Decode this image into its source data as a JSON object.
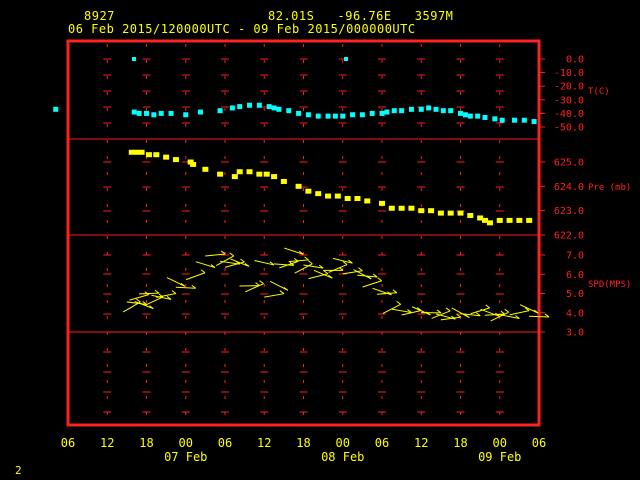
{
  "header": {
    "station": "8927",
    "location": "82.01S   -96.76E   3597M",
    "period": "06 Feb 2015/120000UTC - 09 Feb 2015/000000UTC"
  },
  "page_number": "2",
  "colors": {
    "frame": "#ff2020",
    "temp": "#00ffff",
    "pres": "#ffff00",
    "wind": "#ffff00",
    "text": "#ffff00"
  },
  "chart_data": [
    {
      "type": "scatter",
      "panel": "temperature",
      "ylabel": "T(C)",
      "ylim": [
        -50,
        0
      ],
      "yticks": [
        "0.0",
        "-10.0",
        "-20.0",
        "-30.0",
        "-40.0",
        "-50.0"
      ],
      "grid": true,
      "series": [
        {
          "x": [
            -2.5,
            13.5,
            14.5,
            16,
            17.5,
            19,
            21,
            24,
            27,
            31,
            33.5,
            35,
            37,
            39,
            41,
            42,
            43,
            45,
            47,
            49,
            51,
            53,
            54.5,
            56,
            58,
            60,
            62,
            64,
            65,
            66.5,
            68,
            70,
            72,
            73.5,
            75,
            76.5,
            78,
            80,
            81,
            82,
            83.5,
            85,
            87,
            88.5,
            91,
            93,
            95
          ],
          "y": [
            -37,
            -39,
            -40,
            -40,
            -41,
            -40,
            -40,
            -41,
            -39,
            -38,
            -36,
            -35,
            -34,
            -34,
            -35,
            -36,
            -37,
            -38,
            -40,
            -41,
            -42,
            -42,
            -42,
            -42,
            -41,
            -41,
            -40,
            -40,
            -39,
            -38,
            -38,
            -37,
            -37,
            -36,
            -37,
            -38,
            -38,
            -40,
            -41,
            -42,
            -42,
            -43,
            -44,
            -45,
            -45,
            -45,
            -46
          ]
        }
      ]
    },
    {
      "type": "scatter",
      "panel": "pressure",
      "ylabel": "Pre (mb)",
      "ylim": [
        621.8,
        625.8
      ],
      "yticks": [
        "625.0",
        "624.0",
        "623.0",
        "622.0"
      ],
      "series": [
        {
          "x": [
            13,
            14,
            15,
            16.5,
            18,
            20,
            22,
            25,
            25.5,
            28,
            31,
            34,
            35,
            37,
            39,
            40.5,
            42,
            44,
            47,
            49,
            51,
            53,
            55,
            57,
            59,
            61,
            64,
            66,
            68,
            70,
            72,
            74,
            76,
            78,
            80,
            82,
            84,
            85,
            86,
            88,
            90,
            92,
            94
          ],
          "y": [
            625.4,
            625.4,
            625.4,
            625.3,
            625.3,
            625.2,
            625.1,
            625.0,
            624.9,
            624.7,
            624.5,
            624.4,
            624.6,
            624.6,
            624.5,
            624.5,
            624.4,
            624.2,
            624.0,
            623.8,
            623.7,
            623.6,
            623.6,
            623.5,
            623.5,
            623.4,
            623.3,
            623.1,
            623.1,
            623.1,
            623.0,
            623.0,
            622.9,
            622.9,
            622.9,
            622.8,
            622.7,
            622.6,
            622.5,
            622.6,
            622.6,
            622.6,
            622.6
          ]
        }
      ]
    },
    {
      "type": "scatter",
      "panel": "wind",
      "ylabel": "SPD(MPS)",
      "ylim": [
        3,
        7.6
      ],
      "yticks": [
        "7.0",
        "6.0",
        "5.0",
        "4.0",
        "3.0"
      ],
      "series": [
        {
          "x": [
            13,
            14,
            14.5,
            15.5,
            16.5,
            17.5,
            19,
            20,
            22,
            24,
            26,
            28,
            30,
            32,
            33,
            34,
            35,
            37,
            38,
            40,
            42,
            43,
            44,
            45,
            46,
            47,
            48,
            50,
            51,
            52,
            54,
            55,
            56,
            58,
            60,
            61,
            62,
            64,
            65,
            66,
            68,
            70,
            72,
            74,
            76,
            77,
            78,
            80,
            82,
            84,
            86,
            87,
            88,
            90,
            92,
            94,
            96
          ],
          "y": [
            4.3,
            4.5,
            4.8,
            4.4,
            5.0,
            4.6,
            4.8,
            4.9,
            5.6,
            5.3,
            5.9,
            6.5,
            7.0,
            6.7,
            6.6,
            6.5,
            6.6,
            5.4,
            5.3,
            6.6,
            4.9,
            5.4,
            6.5,
            6.5,
            7.2,
            6.7,
            6.3,
            6.4,
            5.9,
            6.0,
            6.2,
            6.3,
            6.7,
            6.1,
            6.0,
            5.9,
            5.5,
            5.1,
            5.0,
            4.2,
            4.1,
            4.0,
            4.1,
            4.0,
            3.9,
            3.8,
            3.7,
            4.0,
            3.9,
            4.1,
            4.0,
            3.9,
            3.8,
            3.8,
            4.0,
            4.2,
            3.8
          ]
        }
      ]
    }
  ],
  "x_axis": {
    "range_hours": [
      0,
      96
    ],
    "tick_labels": [
      "06",
      "12",
      "18",
      "00",
      "06",
      "12",
      "18",
      "00",
      "06",
      "12",
      "18",
      "00",
      "06"
    ],
    "date_labels": [
      "07 Feb",
      "08 Feb",
      "09 Feb"
    ]
  }
}
